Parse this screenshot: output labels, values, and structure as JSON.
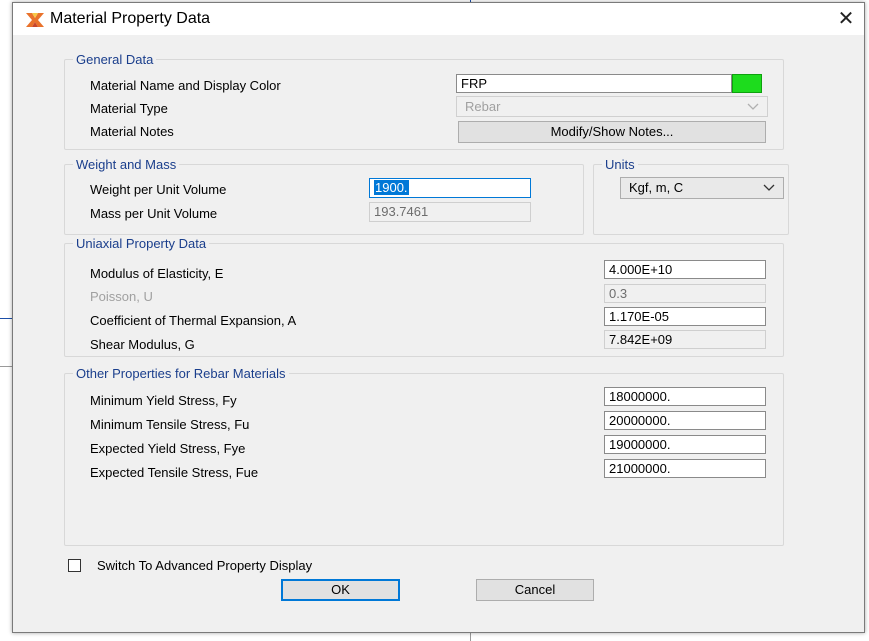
{
  "window": {
    "title": "Material Property Data",
    "close_glyph": "✕",
    "icon": "app-logo-icon"
  },
  "general": {
    "legend": "General Data",
    "name_label": "Material Name and Display Color",
    "name_value": "FRP",
    "display_color": "#1ddc1d",
    "type_label": "Material Type",
    "type_value": "Rebar",
    "notes_label": "Material Notes",
    "notes_button": "Modify/Show Notes..."
  },
  "weight": {
    "legend": "Weight and Mass",
    "weight_label": "Weight per Unit Volume",
    "weight_value": "1900.",
    "mass_label": "Mass per Unit Volume",
    "mass_value": "193.7461"
  },
  "units": {
    "legend": "Units",
    "value": "Kgf, m, C"
  },
  "uniaxial": {
    "legend": "Uniaxial Property Data",
    "e_label": "Modulus of Elasticity,  E",
    "e_value": "4.000E+10",
    "u_label": "Poisson,  U",
    "u_value": "0.3",
    "a_label": "Coefficient of Thermal Expansion,  A",
    "a_value": "1.170E-05",
    "g_label": "Shear Modulus,  G",
    "g_value": "7.842E+09"
  },
  "rebar": {
    "legend": "Other Properties for Rebar Materials",
    "fy_label": "Minimum Yield Stress, Fy",
    "fy_value": "18000000.",
    "fu_label": "Minimum Tensile Stress, Fu",
    "fu_value": "20000000.",
    "fye_label": "Expected Yield Stress, Fye",
    "fye_value": "19000000.",
    "fue_label": "Expected Tensile Stress, Fue",
    "fue_value": "21000000."
  },
  "advanced": {
    "label": "Switch To Advanced Property Display",
    "checked": false
  },
  "buttons": {
    "ok": "OK",
    "cancel": "Cancel"
  }
}
